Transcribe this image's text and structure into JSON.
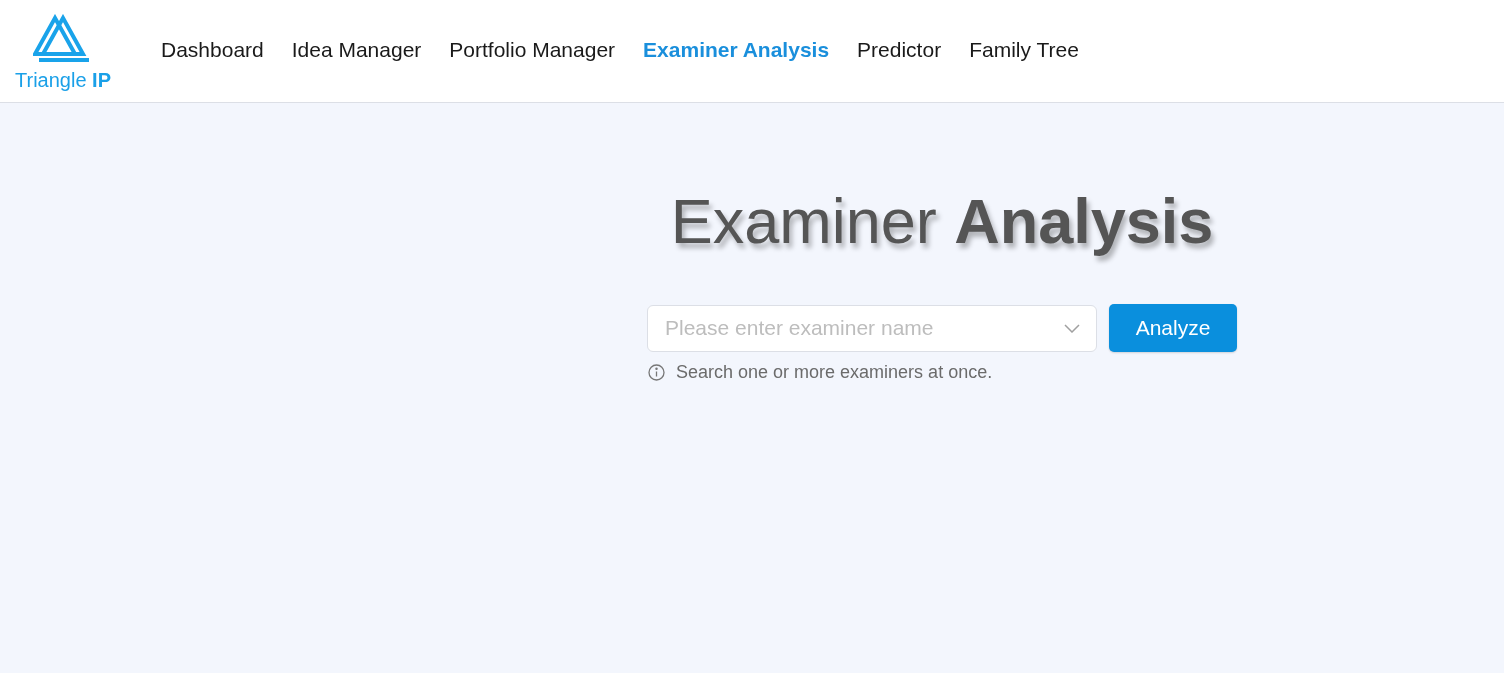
{
  "logo": {
    "text": "Triangle **IP**"
  },
  "nav": [
    {
      "label": "Dashboard",
      "selected": false
    },
    {
      "label": "Idea Manager",
      "selected": false
    },
    {
      "label": "Portfolio Manager",
      "selected": false
    },
    {
      "label": "Examiner Analysis",
      "selected": true
    },
    {
      "label": "Predictor",
      "selected": false
    },
    {
      "label": "Family Tree",
      "selected": false
    }
  ],
  "heading": "Examiner **Analysis**",
  "search": {
    "placeholder": "Please enter examiner name",
    "button": "Analyze",
    "hint": "Search one or more examiners at once."
  }
}
